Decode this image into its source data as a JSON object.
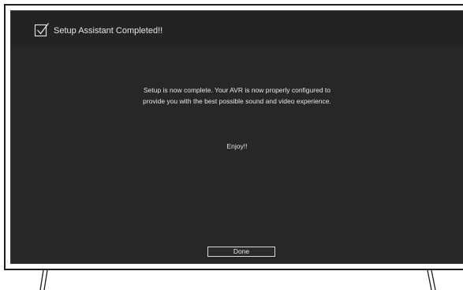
{
  "dialog": {
    "title": "Setup Assistant Completed!!",
    "title_icon": "checkbox-checked-icon",
    "message_line1": "Setup is now complete. Your AVR is now properly configured to",
    "message_line2": "provide you with the best possible sound and video experience.",
    "enjoy_text": "Enjoy!!",
    "done_label": "Done"
  },
  "colors": {
    "screen_bg": "#272727",
    "title_bar_bg": "#232323",
    "text": "#e6e6e6",
    "bezel": "#1e1e1e"
  }
}
